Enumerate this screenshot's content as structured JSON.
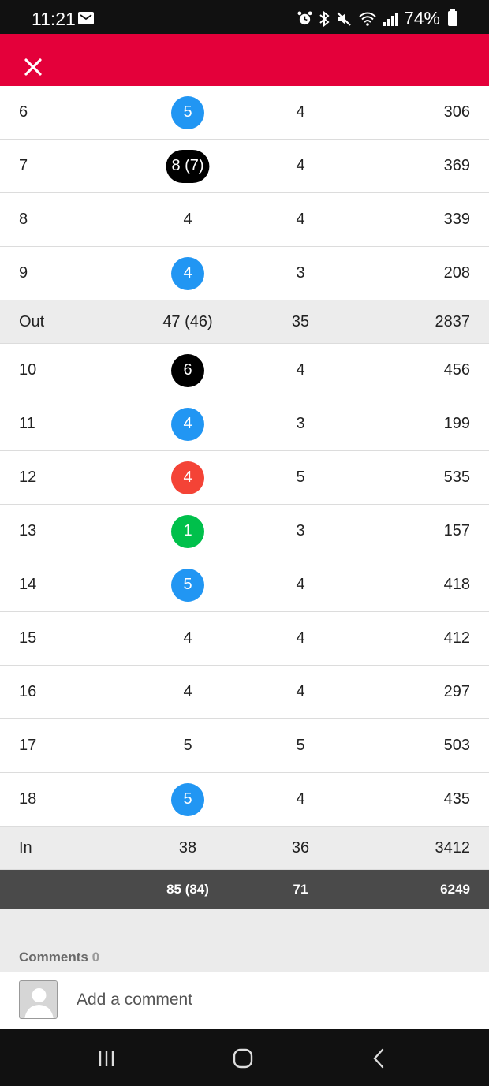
{
  "status_bar": {
    "time": "11:21",
    "battery": "74%"
  },
  "rows": [
    {
      "hole": "6",
      "score": "5",
      "style": "blue",
      "par": "4",
      "yds": "306"
    },
    {
      "hole": "7",
      "score": "8 (7)",
      "style": "black",
      "par": "4",
      "yds": "369"
    },
    {
      "hole": "8",
      "score": "4",
      "style": "plain",
      "par": "4",
      "yds": "339"
    },
    {
      "hole": "9",
      "score": "4",
      "style": "blue",
      "par": "3",
      "yds": "208"
    }
  ],
  "out": {
    "label": "Out",
    "score": "47 (46)",
    "par": "35",
    "yds": "2837"
  },
  "rows_in": [
    {
      "hole": "10",
      "score": "6",
      "style": "black",
      "par": "4",
      "yds": "456"
    },
    {
      "hole": "11",
      "score": "4",
      "style": "blue",
      "par": "3",
      "yds": "199"
    },
    {
      "hole": "12",
      "score": "4",
      "style": "red",
      "par": "5",
      "yds": "535"
    },
    {
      "hole": "13",
      "score": "1",
      "style": "green",
      "par": "3",
      "yds": "157"
    },
    {
      "hole": "14",
      "score": "5",
      "style": "blue",
      "par": "4",
      "yds": "418"
    },
    {
      "hole": "15",
      "score": "4",
      "style": "plain",
      "par": "4",
      "yds": "412"
    },
    {
      "hole": "16",
      "score": "4",
      "style": "plain",
      "par": "4",
      "yds": "297"
    },
    {
      "hole": "17",
      "score": "5",
      "style": "plain",
      "par": "5",
      "yds": "503"
    },
    {
      "hole": "18",
      "score": "5",
      "style": "blue",
      "par": "4",
      "yds": "435"
    }
  ],
  "in": {
    "label": "In",
    "score": "38",
    "par": "36",
    "yds": "3412"
  },
  "total": {
    "score": "85 (84)",
    "par": "71",
    "yds": "6249"
  },
  "comments": {
    "label": "Comments",
    "count": "0",
    "placeholder": "Add a comment"
  },
  "colors": {
    "brand": "#e4003a",
    "blue": "#2196f3",
    "black": "#000000",
    "red": "#f44336",
    "green": "#00c04b",
    "total_bg": "#4a4a4a"
  },
  "icons": {
    "close": "close-icon",
    "avatar": "avatar-placeholder-icon",
    "recents": "recents-icon",
    "home": "home-icon",
    "back": "back-icon"
  }
}
